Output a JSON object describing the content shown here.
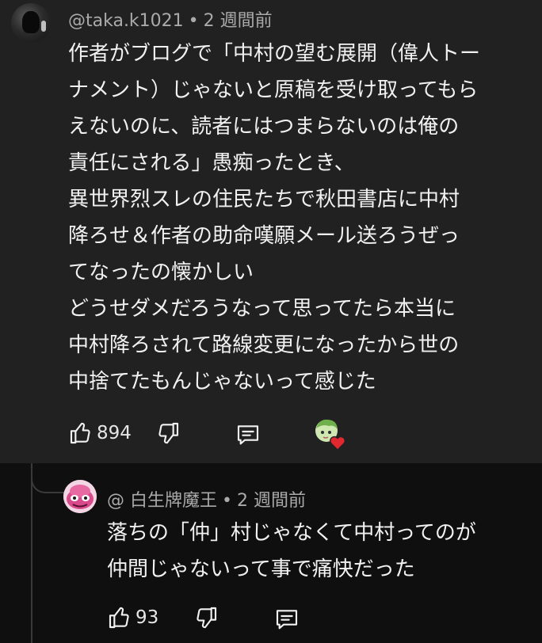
{
  "comment": {
    "author": "@taka.k1021",
    "separator": "•",
    "time": "2 週間前",
    "lines": [
      "作者がブログで「中村の望む展開（偉人トー",
      "ナメント）じゃないと原稿を受け取ってもら",
      "えないのに、読者にはつまらないのは俺の",
      "責任にされる」愚痴ったとき、",
      "異世界烈スレの住民たちで秋田書店に中村",
      "降ろせ＆作者の助命嘆願メール送ろうぜっ",
      "てなったの懐かしい",
      "どうせダメだろうなって思ってたら本当に",
      "中村降ろされて路線変更になったから世の",
      "中捨てたもんじゃないって感じた"
    ],
    "like_count": "894",
    "icons": {
      "like": "thumbs-up-icon",
      "dislike": "thumbs-down-icon",
      "reply": "reply-comment-icon",
      "creator_heart": "creator-heart-avatar"
    }
  },
  "reply": {
    "author": "@ 白生牌魔王",
    "separator": "•",
    "time": "2 週間前",
    "lines": [
      "落ちの「仲」村じゃなくて中村ってのが",
      "仲間じゃないって事で痛快だった"
    ],
    "like_count": "93",
    "icons": {
      "like": "thumbs-up-icon",
      "dislike": "thumbs-down-icon",
      "reply": "reply-comment-icon"
    }
  },
  "colors": {
    "comment_bg": "#212121",
    "reply_bg": "#0f0f0f",
    "text": "#f1f1f1",
    "meta": "#aaaaaa",
    "heart": "#e0282e"
  }
}
